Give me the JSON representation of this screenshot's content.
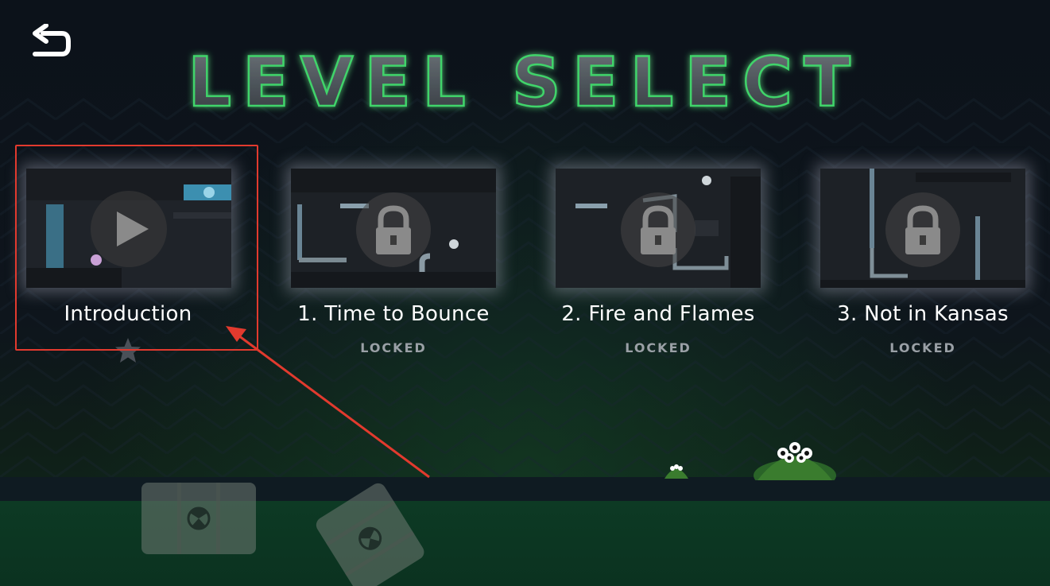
{
  "screen": {
    "title": "LEVEL SELECT",
    "back_icon": "back-arrow-icon"
  },
  "levels": [
    {
      "name": "Introduction",
      "status": "",
      "stars": 1,
      "unlocked": true,
      "icon": "play-icon"
    },
    {
      "name": "1. Time to Bounce",
      "status": "LOCKED",
      "unlocked": false,
      "icon": "lock-icon"
    },
    {
      "name": "2. Fire and Flames",
      "status": "LOCKED",
      "unlocked": false,
      "icon": "lock-icon"
    },
    {
      "name": "3. Not in Kansas",
      "status": "LOCKED",
      "unlocked": false,
      "icon": "lock-icon"
    }
  ],
  "colors": {
    "title_glow": "#2fbf55",
    "highlight": "#e23a2e",
    "acid": "#0d3a24"
  }
}
